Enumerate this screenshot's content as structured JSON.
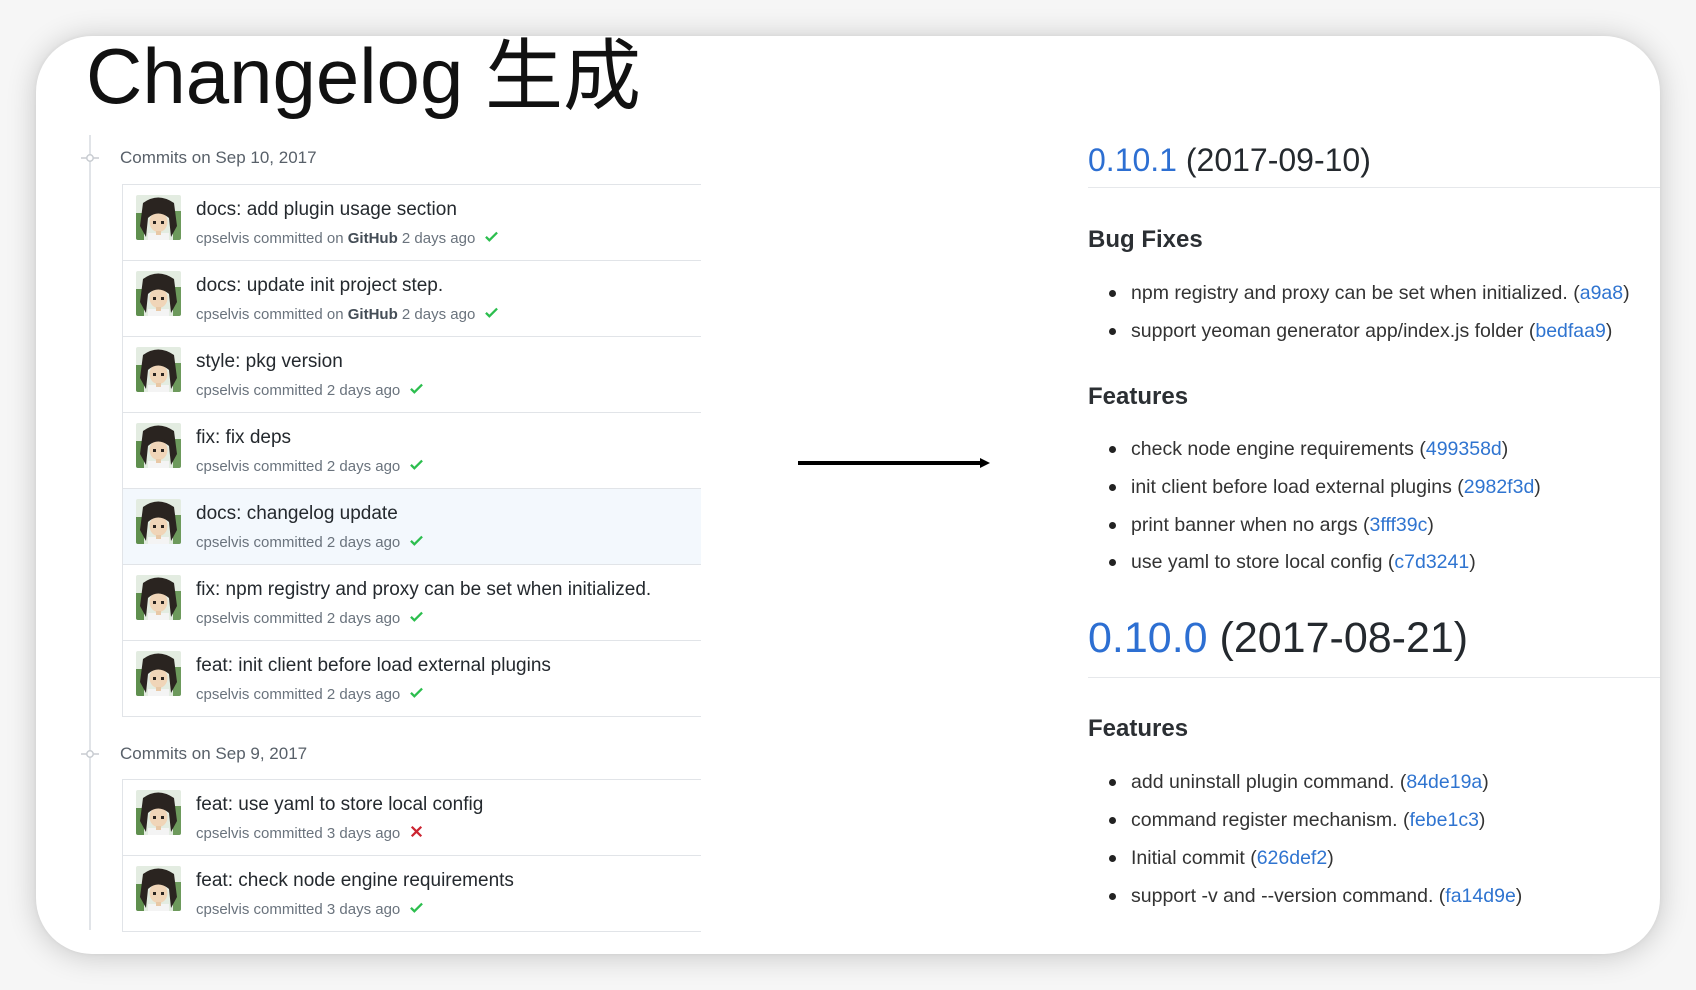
{
  "title": "Changelog 生成",
  "commit_history": {
    "groups": [
      {
        "date_label": "Commits on Sep 10, 2017",
        "commits": [
          {
            "message": "docs: add plugin usage section",
            "author": "cpselvis",
            "action": "committed",
            "via_prefix": "on",
            "via": "GitHub",
            "time": "2 days ago",
            "status": "success"
          },
          {
            "message": "docs: update init project step.",
            "author": "cpselvis",
            "action": "committed",
            "via_prefix": "on",
            "via": "GitHub",
            "time": "2 days ago",
            "status": "success"
          },
          {
            "message": "style: pkg version",
            "author": "cpselvis",
            "action": "committed",
            "time": "2 days ago",
            "status": "success"
          },
          {
            "message": "fix: fix deps",
            "author": "cpselvis",
            "action": "committed",
            "time": "2 days ago",
            "status": "success"
          },
          {
            "message": "docs: changelog update",
            "author": "cpselvis",
            "action": "committed",
            "time": "2 days ago",
            "status": "success",
            "highlighted": true
          },
          {
            "message": "fix: npm registry and proxy can be set when initialized.",
            "author": "cpselvis",
            "action": "committed",
            "time": "2 days ago",
            "status": "success"
          },
          {
            "message": "feat: init client before load external plugins",
            "author": "cpselvis",
            "action": "committed",
            "time": "2 days ago",
            "status": "success"
          }
        ]
      },
      {
        "date_label": "Commits on Sep 9, 2017",
        "commits": [
          {
            "message": "feat: use yaml to store local config",
            "author": "cpselvis",
            "action": "committed",
            "time": "3 days ago",
            "status": "failure"
          },
          {
            "message": "feat: check node engine requirements",
            "author": "cpselvis",
            "action": "committed",
            "time": "3 days ago",
            "status": "success"
          }
        ]
      }
    ]
  },
  "changelog": {
    "releases": [
      {
        "version": "0.10.1",
        "date": "(2017-09-10)",
        "sections": [
          {
            "heading": "Bug Fixes",
            "items": [
              {
                "text": "npm registry and proxy can be set when initialized.",
                "hash": "a9a8"
              },
              {
                "text": "support yeoman generator app/index.js folder",
                "hash": "bedfaa9"
              }
            ]
          },
          {
            "heading": "Features",
            "items": [
              {
                "text": "check node engine requirements",
                "hash": "499358d"
              },
              {
                "text": "init client before load external plugins",
                "hash": "2982f3d"
              },
              {
                "text": "print banner when no args",
                "hash": "3fff39c"
              },
              {
                "text": "use yaml to store local config",
                "hash": "c7d3241"
              }
            ]
          }
        ]
      },
      {
        "version": "0.10.0",
        "date": "(2017-08-21)",
        "sections": [
          {
            "heading": "Features",
            "items": [
              {
                "text": "add uninstall plugin command.",
                "hash": "84de19a"
              },
              {
                "text": "command register mechanism.",
                "hash": "febe1c3"
              },
              {
                "text": "Initial commit",
                "hash": "626def2"
              },
              {
                "text": "support -v and --version command.",
                "hash": "fa14d9e"
              }
            ]
          }
        ]
      }
    ]
  },
  "icons": {
    "success": "check-icon",
    "failure": "x-icon",
    "group": "git-commit-icon",
    "transition": "arrow-right-icon"
  },
  "colors": {
    "link_blue": "#2d6fd2",
    "success_green": "#2cbe4e",
    "failure_red": "#cb2431",
    "highlight_row": "#f3f8fd",
    "border": "#e1e4e8"
  }
}
